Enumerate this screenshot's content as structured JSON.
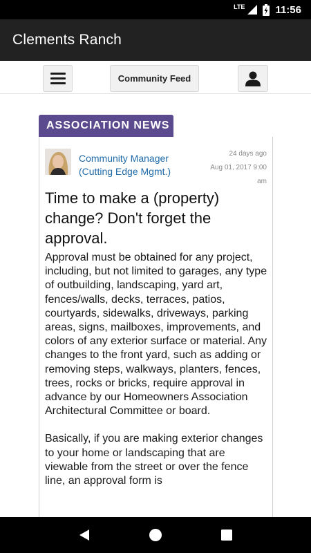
{
  "status_bar": {
    "network": "LTE",
    "time": "11:56",
    "icons": [
      "signal-icon",
      "battery-charging-icon"
    ]
  },
  "app_bar": {
    "title": "Clements Ranch"
  },
  "toolbar": {
    "menu_icon": "hamburger-menu-icon",
    "feed_label": "Community Feed",
    "profile_icon": "user-profile-icon"
  },
  "post": {
    "category": "ASSOCIATION NEWS",
    "author_line1": "Community Manager",
    "author_line2": "(Cutting Edge Mgmt.)",
    "relative_time": "24 days ago",
    "date_line1": "Aug 01, 2017 9:00",
    "date_line2": "am",
    "title": "Time to make a (property) change? Don't forget the approval.",
    "paragraphs": [
      "Approval must be obtained for any project, including, but not limited to garages, any type of outbuilding, landscaping, yard art, fences/walls, decks, terraces, patios, courtyards, sidewalks, driveways, parking areas, signs, mailboxes, improvements, and colors of any exterior surface or material. Any changes to the front yard, such as adding or removing steps, walkways, planters, fences, trees, rocks or bricks, require approval in advance by our Homeowners Association Architectural Committee or board.",
      "Basically, if you are making exterior changes to your home or landscaping that are viewable from the street or over the fence line, an approval form is"
    ]
  },
  "nav_bar": {
    "icons": [
      "back-icon",
      "home-icon",
      "recents-icon"
    ]
  },
  "colors": {
    "app_bar": "#222222",
    "category_tag": "#5b4a8e",
    "author_link": "#1f6aa8"
  }
}
